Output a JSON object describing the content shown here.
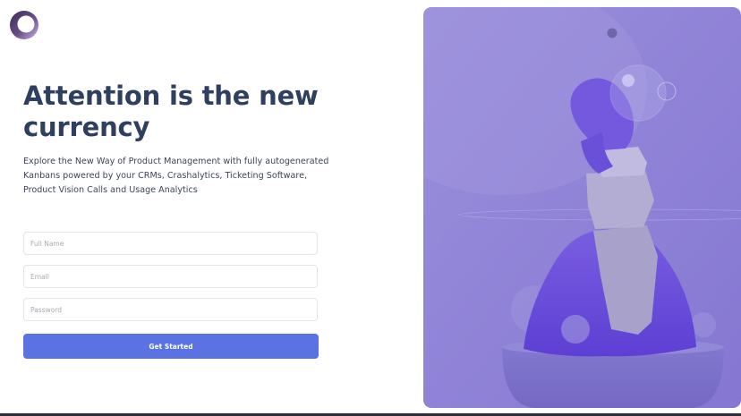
{
  "brand": {
    "logo_icon": "ring-logo-icon"
  },
  "hero_text": {
    "headline": "Attention is the new currency",
    "subtext": "Explore the New Way of Product Management with fully autogenerated Kanbans powered by your CRMs, Crashalytics, Ticketing Software, Product Vision Calls and Usage Analytics"
  },
  "form": {
    "full_name": {
      "value": "",
      "placeholder": "Full Name"
    },
    "email": {
      "value": "",
      "placeholder": "Email"
    },
    "password": {
      "value": "",
      "placeholder": "Password"
    },
    "submit_label": "Get Started"
  },
  "hero_image": {
    "description_icon": "abstract-sculpture-image"
  },
  "colors": {
    "accent": "#5a72e2",
    "heading": "#2e3f5f",
    "hero_tint": "#8f86d9"
  }
}
